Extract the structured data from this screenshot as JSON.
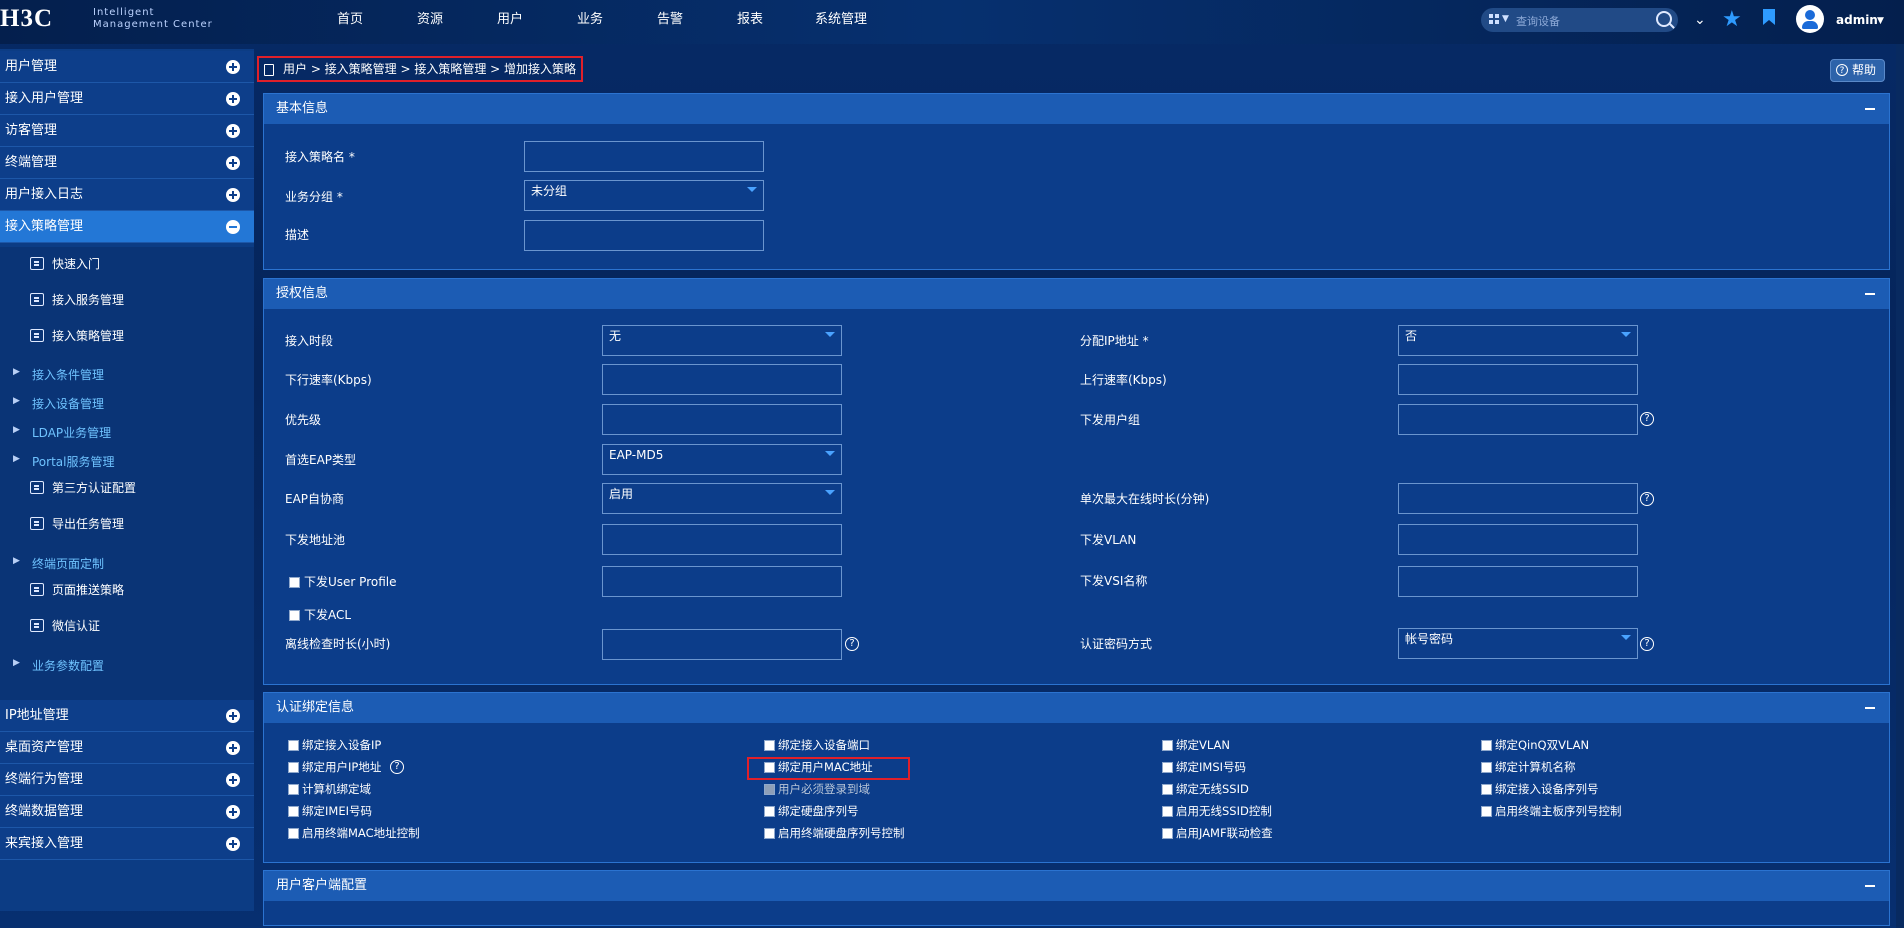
{
  "header": {
    "logo": "H3C",
    "logo_sub_1": "Intelligent",
    "logo_sub_2": "Management Center",
    "nav": [
      "首页",
      "资源",
      "用户",
      "业务",
      "告警",
      "报表",
      "系统管理"
    ],
    "search_placeholder": "查询设备",
    "user": "admin"
  },
  "sidebar": {
    "top_items": [
      "用户管理",
      "接入用户管理",
      "访客管理",
      "终端管理",
      "用户接入日志",
      "接入策略管理"
    ],
    "submenu": [
      {
        "type": "leaf",
        "label": "快速入门"
      },
      {
        "type": "leaf",
        "label": "接入服务管理"
      },
      {
        "type": "leaf",
        "label": "接入策略管理"
      },
      {
        "type": "group",
        "label": "接入条件管理"
      },
      {
        "type": "group",
        "label": "接入设备管理"
      },
      {
        "type": "group",
        "label": "LDAP业务管理"
      },
      {
        "type": "group",
        "label": "Portal服务管理"
      },
      {
        "type": "leaf",
        "label": "第三方认证配置"
      },
      {
        "type": "leaf",
        "label": "导出任务管理"
      },
      {
        "type": "group",
        "label": "终端页面定制"
      },
      {
        "type": "leaf",
        "label": "页面推送策略"
      },
      {
        "type": "leaf",
        "label": "微信认证"
      },
      {
        "type": "group",
        "label": "业务参数配置"
      }
    ],
    "bottom_items": [
      "IP地址管理",
      "桌面资产管理",
      "终端行为管理",
      "终端数据管理",
      "来宾接入管理"
    ]
  },
  "breadcrumb": "用户 > 接入策略管理 > 接入策略管理 > 增加接入策略",
  "help_label": "帮助",
  "basic": {
    "title": "基本信息",
    "name_label": "接入策略名 *",
    "group_label": "业务分组 *",
    "group_value": "未分组",
    "desc_label": "描述"
  },
  "auth": {
    "title": "授权信息",
    "left": {
      "period_label": "接入时段",
      "period_value": "无",
      "down_rate_label": "下行速率(Kbps)",
      "priority_label": "优先级",
      "eap_label": "首选EAP类型",
      "eap_value": "EAP-MD5",
      "eap_nego_label": "EAP自协商",
      "eap_nego_value": "启用",
      "pool_label": "下发地址池",
      "user_profile_label": "下发User Profile",
      "acl_label": "下发ACL",
      "offline_label": "离线检查时长(小时)"
    },
    "right": {
      "assign_ip_label": "分配IP地址 *",
      "assign_ip_value": "否",
      "up_rate_label": "上行速率(Kbps)",
      "user_group_label": "下发用户组",
      "max_online_label": "单次最大在线时长(分钟)",
      "vlan_label": "下发VLAN",
      "vsi_label": "下发VSI名称",
      "pwd_mode_label": "认证密码方式",
      "pwd_mode_value": "帐号密码"
    }
  },
  "binding": {
    "title": "认证绑定信息",
    "columns": [
      [
        "绑定接入设备IP",
        "绑定用户IP地址",
        "计算机绑定域",
        "绑定IMEI号码",
        "启用终端MAC地址控制"
      ],
      [
        "绑定接入设备端口",
        "绑定用户MAC地址",
        "用户必须登录到域",
        "绑定硬盘序列号",
        "启用终端硬盘序列号控制"
      ],
      [
        "绑定VLAN",
        "绑定IMSI号码",
        "绑定无线SSID",
        "启用无线SSID控制",
        "启用JAMF联动检查"
      ],
      [
        "绑定QinQ双VLAN",
        "绑定计算机名称",
        "绑定接入设备序列号",
        "启用终端主板序列号控制"
      ]
    ]
  },
  "client": {
    "title": "用户客户端配置"
  }
}
